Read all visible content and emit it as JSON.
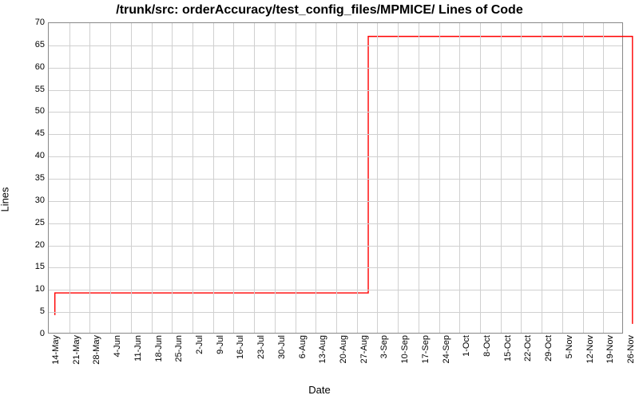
{
  "chart_data": {
    "type": "line",
    "title": "/trunk/src: orderAccuracy/test_config_files/MPMICE/ Lines of Code",
    "xlabel": "Date",
    "ylabel": "Lines",
    "ylim": [
      0,
      70
    ],
    "yticks": [
      0,
      5,
      10,
      15,
      20,
      25,
      30,
      35,
      40,
      45,
      50,
      55,
      60,
      65,
      70
    ],
    "categories": [
      "14-May",
      "21-May",
      "28-May",
      "4-Jun",
      "11-Jun",
      "18-Jun",
      "25-Jun",
      "2-Jul",
      "9-Jul",
      "16-Jul",
      "23-Jul",
      "30-Jul",
      "6-Aug",
      "13-Aug",
      "20-Aug",
      "27-Aug",
      "3-Sep",
      "10-Sep",
      "17-Sep",
      "24-Sep",
      "1-Oct",
      "8-Oct",
      "15-Oct",
      "22-Oct",
      "29-Oct",
      "5-Nov",
      "12-Nov",
      "19-Nov",
      "26-Nov"
    ],
    "series": [
      {
        "name": "LOC",
        "color": "#ff0000",
        "points": [
          {
            "xi": 0.3,
            "y": 4
          },
          {
            "xi": 0.3,
            "y": 9
          },
          {
            "xi": 15.6,
            "y": 9
          },
          {
            "xi": 15.6,
            "y": 67
          },
          {
            "xi": 28.5,
            "y": 67
          },
          {
            "xi": 28.5,
            "y": 2
          }
        ]
      }
    ]
  }
}
